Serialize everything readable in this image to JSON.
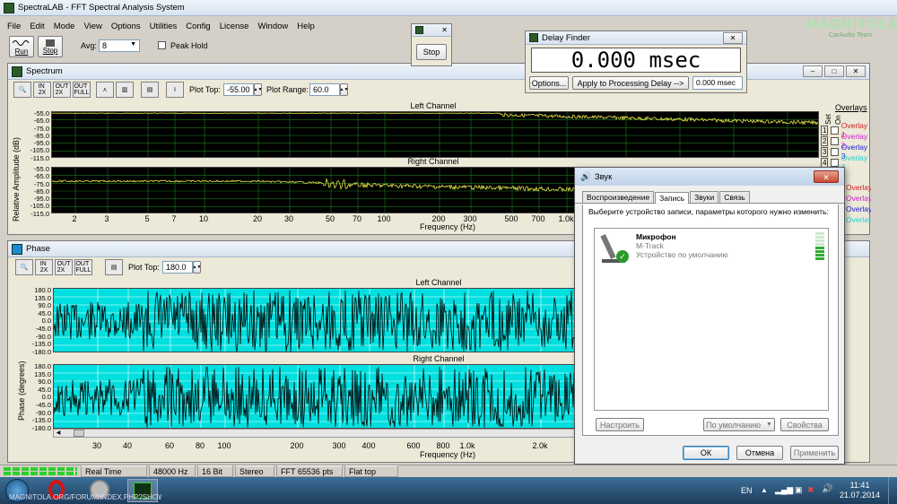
{
  "app": {
    "title": "SpectraLAB - FFT Spectral Analysis System",
    "menu": [
      "File",
      "Edit",
      "Mode",
      "View",
      "Options",
      "Utilities",
      "Config",
      "License",
      "Window",
      "Help"
    ],
    "run_label": "Run",
    "stop_label": "Stop",
    "avg_label": "Avg:",
    "avg_value": "8",
    "peak_hold_label": "Peak Hold"
  },
  "stop_window": {
    "button_label": "Stop"
  },
  "delay_finder": {
    "title": "Delay Finder",
    "display": "0.000 msec",
    "options_label": "Options...",
    "apply_label": "Apply to Processing Delay -->",
    "value": "0.000 msec"
  },
  "spectrum": {
    "title": "Spectrum",
    "plot_top_label": "Plot Top:",
    "plot_top_value": "-55.00",
    "plot_range_label": "Plot Range:",
    "plot_range_value": "60.0",
    "left_channel": "Left Channel",
    "right_channel": "Right Channel",
    "yaxis_label": "Relative Amplitude (dB)",
    "yticks": [
      "-55.0",
      "-65.0",
      "-75.0",
      "-85.0",
      "-95.0",
      "-105.0",
      "-115.0"
    ],
    "xticks": [
      "2",
      "3",
      "5",
      "7",
      "10",
      "20",
      "30",
      "50",
      "70",
      "100",
      "200",
      "300",
      "500",
      "700",
      "1.0k"
    ],
    "xlabel": "Frequency (Hz)",
    "overlays_title": "Overlays",
    "set_label": "Set",
    "on_label": "On",
    "overlays": [
      {
        "num": "1",
        "name": "Overlay 1",
        "color": "#d02020"
      },
      {
        "num": "2",
        "name": "Overlay 2",
        "color": "#d020d0"
      },
      {
        "num": "3",
        "name": "Overlay 3",
        "color": "#2020d0"
      },
      {
        "num": "4",
        "name": "Overlay 4",
        "color": "#20d0d0"
      }
    ],
    "overlays_lower": [
      {
        "name": "Overlay 1",
        "color": "#d02020"
      },
      {
        "name": "Overlay 2",
        "color": "#d020d0"
      },
      {
        "name": "Overlay 3",
        "color": "#2020d0"
      },
      {
        "name": "Overlay 4",
        "color": "#20d0d0"
      }
    ]
  },
  "phase": {
    "title": "Phase",
    "plot_top_label": "Plot Top:",
    "plot_top_value": "180.0",
    "left_channel": "Left Channel",
    "right_channel": "Right Channel",
    "yaxis_label": "Phase (degrees)",
    "yticks": [
      "180.0",
      "135.0",
      "90.0",
      "45.0",
      "0.0",
      "-45.0",
      "-90.0",
      "-135.0",
      "-180.0"
    ],
    "xticks": [
      "30",
      "40",
      "60",
      "80",
      "100",
      "200",
      "300",
      "400",
      "600",
      "800",
      "1.0k",
      "2.0k"
    ],
    "xlabel": "Frequency (Hz)"
  },
  "sound_dialog": {
    "title": "Звук",
    "tabs": [
      "Воспроизведение",
      "Запись",
      "Звуки",
      "Связь"
    ],
    "instruction": "Выберите устройство записи, параметры которого нужно изменить:",
    "device_name": "Микрофон",
    "device_model": "M-Track",
    "device_status": "Устройство по умолчанию",
    "configure_label": "Настроить",
    "default_label": "По умолчанию",
    "properties_label": "Свойства",
    "ok_label": "ОК",
    "cancel_label": "Отмена",
    "apply_label": "Применить"
  },
  "statusbar": {
    "mode": "Real Time",
    "rate": "48000 Hz",
    "bits": "16 Bit",
    "channels": "Stereo",
    "fft": "FFT 65536 pts",
    "window": "Flat top"
  },
  "watermark": {
    "brand": "MAGNITOLA",
    "sub": "CarAudio Team"
  },
  "taskbar": {
    "lang": "EN",
    "time": "11:41",
    "date": "21.07.2014",
    "watermark_url": "MAGNITOLA.ORG/FORUM/INDEX.PHP?SHOWTOPIC=55671"
  }
}
